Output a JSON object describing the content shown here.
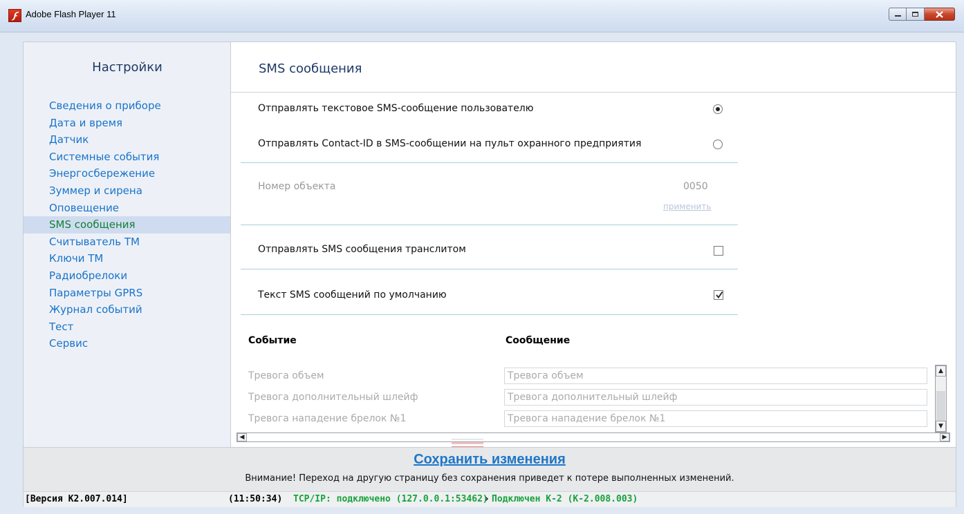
{
  "window": {
    "title": "Adobe Flash Player 11",
    "icon": "flash-icon",
    "controls": [
      "minimize",
      "maximize",
      "close"
    ]
  },
  "sidebar": {
    "title": "Настройки",
    "items": [
      {
        "label": "Сведения о приборе"
      },
      {
        "label": "Дата и время"
      },
      {
        "label": "Датчик"
      },
      {
        "label": "Системные события"
      },
      {
        "label": "Энергосбережение"
      },
      {
        "label": "Зуммер и сирена"
      },
      {
        "label": "Оповещение"
      },
      {
        "label": "SMS сообщения",
        "active": true
      },
      {
        "label": "Считыватель ТМ"
      },
      {
        "label": "Ключи ТМ"
      },
      {
        "label": "Радиобрелоки"
      },
      {
        "label": "Параметры GPRS"
      },
      {
        "label": "Журнал событий"
      },
      {
        "label": "Тест"
      },
      {
        "label": "Сервис"
      }
    ]
  },
  "content": {
    "title": "SMS сообщения",
    "send_text_option": {
      "label": "Отправлять текстовое SMS-сообщение пользователю",
      "selected": true
    },
    "send_contactid_option": {
      "label": "Отправлять Contact-ID в SMS-сообщении на пульт охранного предприятия",
      "selected": false
    },
    "object_number": {
      "label": "Номер объекта",
      "value": "0050",
      "apply_label": "применить"
    },
    "translit": {
      "label": "Отправлять SMS сообщения транслитом",
      "checked": false
    },
    "default_text": {
      "label": "Текст SMS сообщений по умолчанию",
      "checked": true
    },
    "table": {
      "headers": {
        "event": "Событие",
        "message": "Сообщение"
      },
      "rows": [
        {
          "event": "Тревога объем",
          "message": "Тревога объем"
        },
        {
          "event": "Тревога дополнительный шлейф",
          "message": "Тревога дополнительный шлейф"
        },
        {
          "event": "Тревога нападение брелок №1",
          "message": "Тревога нападение брелок №1"
        }
      ]
    }
  },
  "footer": {
    "save_label": "Сохранить изменения",
    "warning": "Внимание! Переход на другую страницу без сохранения приведет к потере выполненных изменений."
  },
  "status": {
    "version": "[Версия К2.007.014]",
    "time": "(11:50:34)",
    "connection": "TCP/IP: подключено (127.0.0.1:53462)",
    "separator": "›",
    "device": "Подключен К-2 (К-2.008.003)",
    "colors": {
      "connection": "#17a23a",
      "time": "#000000"
    }
  },
  "colors": {
    "accent": "#1a73c9",
    "active_item": "#13803a",
    "save_arrow": "#e0261c"
  }
}
